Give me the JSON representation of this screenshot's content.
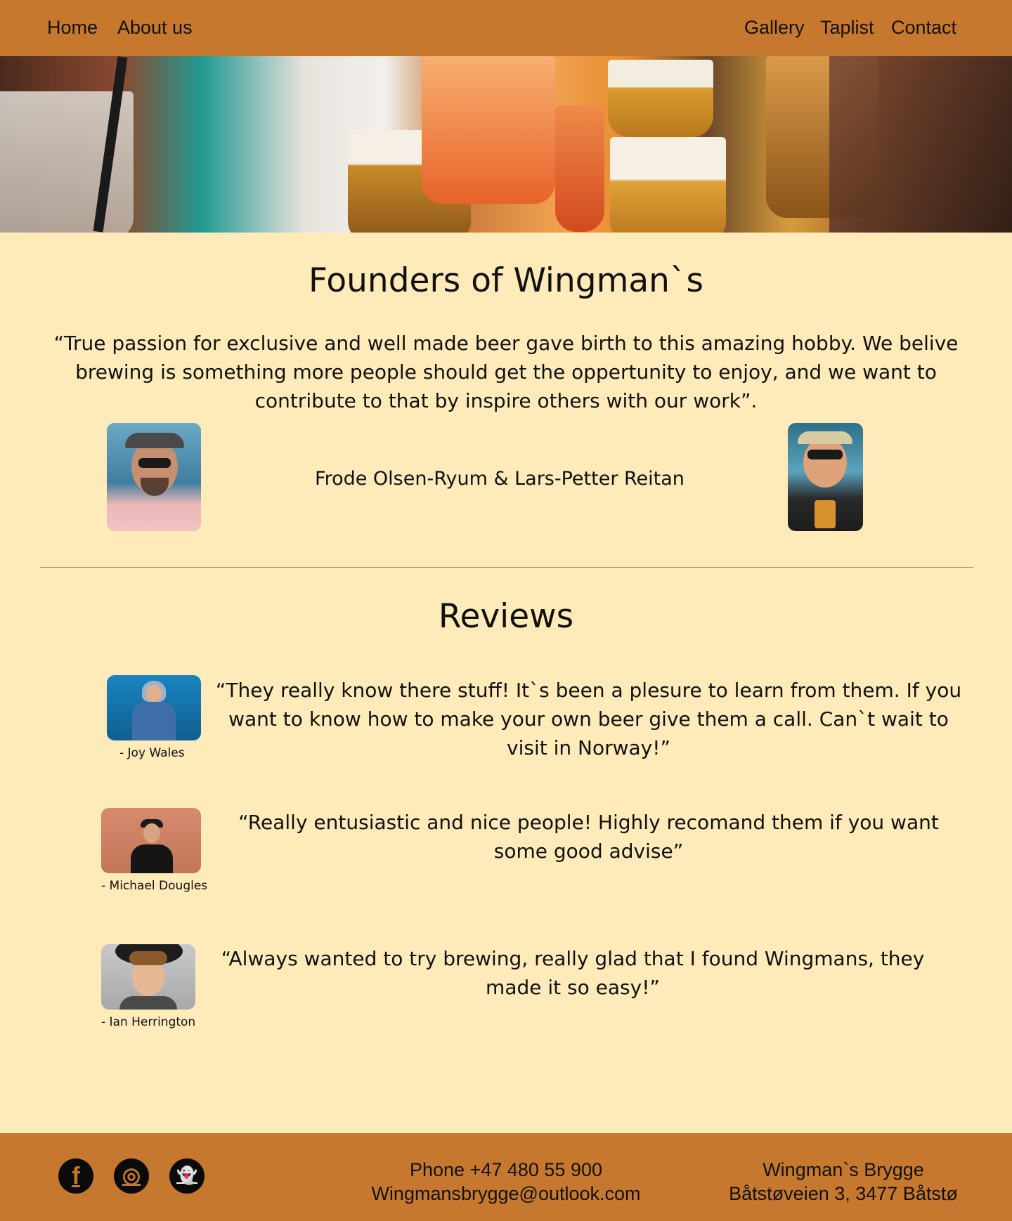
{
  "nav": {
    "home": "Home",
    "about": "About us",
    "gallery": "Gallery",
    "taplist": "Taplist",
    "contact": "Contact"
  },
  "founders": {
    "heading": "Founders of Wingman`s",
    "quote": "“True passion for exclusive and well made beer gave birth to this amazing hobby. We belive brewing is something more people should get the oppertunity to enjoy, and we want to contribute to that by inspire others with our work”.",
    "names": "Frode Olsen-Ryum & Lars-Petter Reitan"
  },
  "reviews": {
    "heading": "Reviews",
    "items": [
      {
        "quote": "“They really know there stuff! It`s been a plesure to learn from them. If you want to know how to make your own beer give them a call. Can`t wait to visit in Norway!”",
        "author": "- Joy Wales"
      },
      {
        "quote": "“Really entusiastic and nice people! Highly recomand them if you want some good advise”",
        "author": "- Michael Dougles"
      },
      {
        "quote": "“Always wanted to try brewing, really glad that I found Wingmans, they made it so easy!”",
        "author": "- Ian Herrington"
      }
    ]
  },
  "footer": {
    "phone": "Phone +47  480 55 900",
    "email": "Wingmansbrygge@outlook.com",
    "company": "Wingman`s Brygge",
    "address": "Båtstøveien 3, 3477 Båtstø",
    "social": [
      {
        "icon": "facebook-icon",
        "glyph": "f"
      },
      {
        "icon": "instagram-icon",
        "glyph": "◎"
      },
      {
        "icon": "snapchat-icon",
        "glyph": "👻"
      }
    ]
  },
  "colors": {
    "nav_bg": "#c6792e",
    "page_bg": "#ffeab9",
    "divider": "#c6792e"
  }
}
